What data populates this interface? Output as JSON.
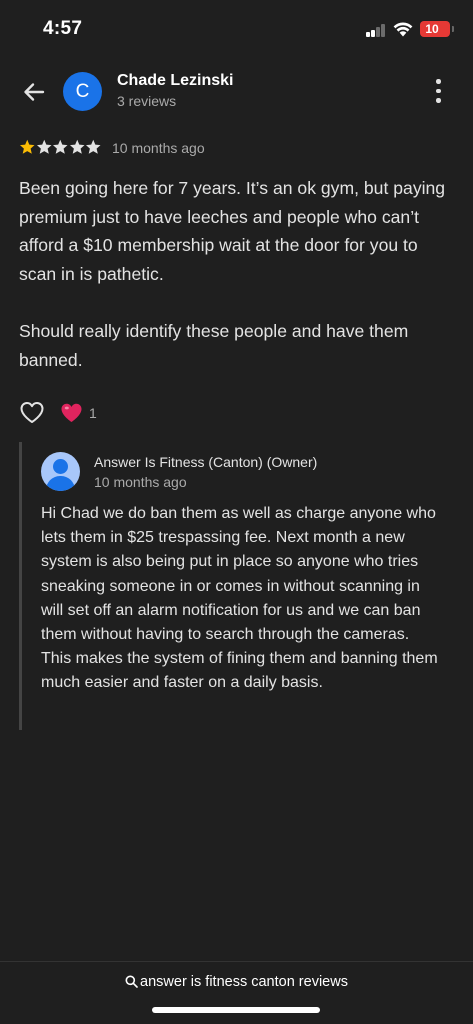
{
  "status_bar": {
    "time": "4:57",
    "battery": "10",
    "battery_color": "#e53935",
    "signal_bars_active": 2,
    "signal_bars_total": 4
  },
  "header": {
    "avatar_letter": "C",
    "avatar_color": "#1a73e8",
    "reviewer_name": "Chade Lezinski",
    "review_count": "3 reviews",
    "back_icon": "arrow-back-icon",
    "menu_icon": "more-vertical-icon"
  },
  "review": {
    "rating": 1,
    "rating_max": 5,
    "date": "10 months ago",
    "text": "Been going here for 7 years. It’s an ok gym, but paying premium just to have leeches and people who can’t afford a $10 membership wait at the door for you to scan in is pathetic.\n\nShould really identify these people and have them banned."
  },
  "reactions": {
    "like_icon": "heart-outline-icon",
    "reaction_icon": "red-heart-icon",
    "count": "1"
  },
  "owner_reply": {
    "name": "Answer Is Fitness (Canton) (Owner)",
    "date": "10 months ago",
    "avatar_icon": "person-icon",
    "text": "Hi Chad we do ban them as well as charge anyone who lets them in $25 trespassing fee. Next month a new system is also being put in place so anyone who tries sneaking someone in or comes in without scanning in will set off an alarm notification for us and we can ban them without having to search through the cameras. This makes the system of fining them and banning them much easier and faster on a daily basis."
  },
  "bottom_bar": {
    "search_icon": "search-icon",
    "search_text": "answer is fitness canton reviews"
  },
  "colors": {
    "background": "#1f1f1f",
    "star_filled": "#fbbc04",
    "star_empty": "#e3e3e3",
    "heart": "#e0245e"
  }
}
